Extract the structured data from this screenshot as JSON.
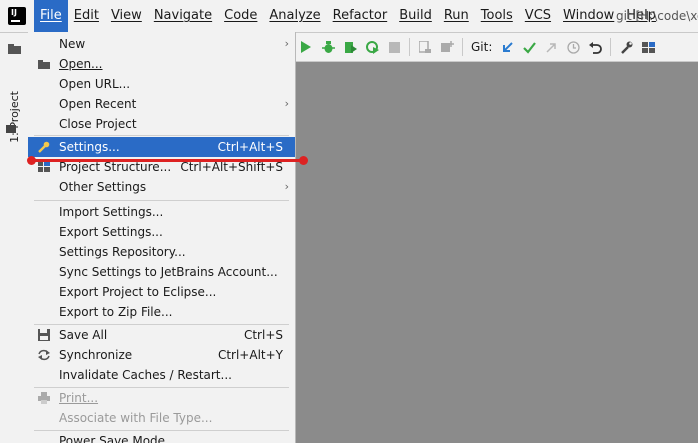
{
  "menubar": {
    "items": [
      {
        "label": "File"
      },
      {
        "label": "Edit"
      },
      {
        "label": "View"
      },
      {
        "label": "Navigate"
      },
      {
        "label": "Code"
      },
      {
        "label": "Analyze"
      },
      {
        "label": "Refactor"
      },
      {
        "label": "Build"
      },
      {
        "label": "Run"
      },
      {
        "label": "Tools"
      },
      {
        "label": "VCS"
      },
      {
        "label": "Window"
      },
      {
        "label": "Help"
      }
    ],
    "title": "git [H:\\code\\xo"
  },
  "toolbar": {
    "git_label": "Git:"
  },
  "sidebar": {
    "project_tab": "1: Project"
  },
  "file_menu": {
    "items": [
      {
        "label": "New"
      },
      {
        "label": "Open..."
      },
      {
        "label": "Open URL..."
      },
      {
        "label": "Open Recent"
      },
      {
        "label": "Close Project"
      },
      {
        "label": "Settings...",
        "shortcut": "Ctrl+Alt+S"
      },
      {
        "label": "Project Structure...",
        "shortcut": "Ctrl+Alt+Shift+S"
      },
      {
        "label": "Other Settings"
      },
      {
        "label": "Import Settings..."
      },
      {
        "label": "Export Settings..."
      },
      {
        "label": "Settings Repository..."
      },
      {
        "label": "Sync Settings to JetBrains Account..."
      },
      {
        "label": "Export Project to Eclipse..."
      },
      {
        "label": "Export to Zip File..."
      },
      {
        "label": "Save All",
        "shortcut": "Ctrl+S"
      },
      {
        "label": "Synchronize",
        "shortcut": "Ctrl+Alt+Y"
      },
      {
        "label": "Invalidate Caches / Restart..."
      },
      {
        "label": "Print..."
      },
      {
        "label": "Associate with File Type..."
      },
      {
        "label": "Power Save Mode"
      }
    ]
  },
  "colors": {
    "selection": "#2a6bc6",
    "annotation": "#dd2222",
    "run_green": "#3aa845"
  }
}
